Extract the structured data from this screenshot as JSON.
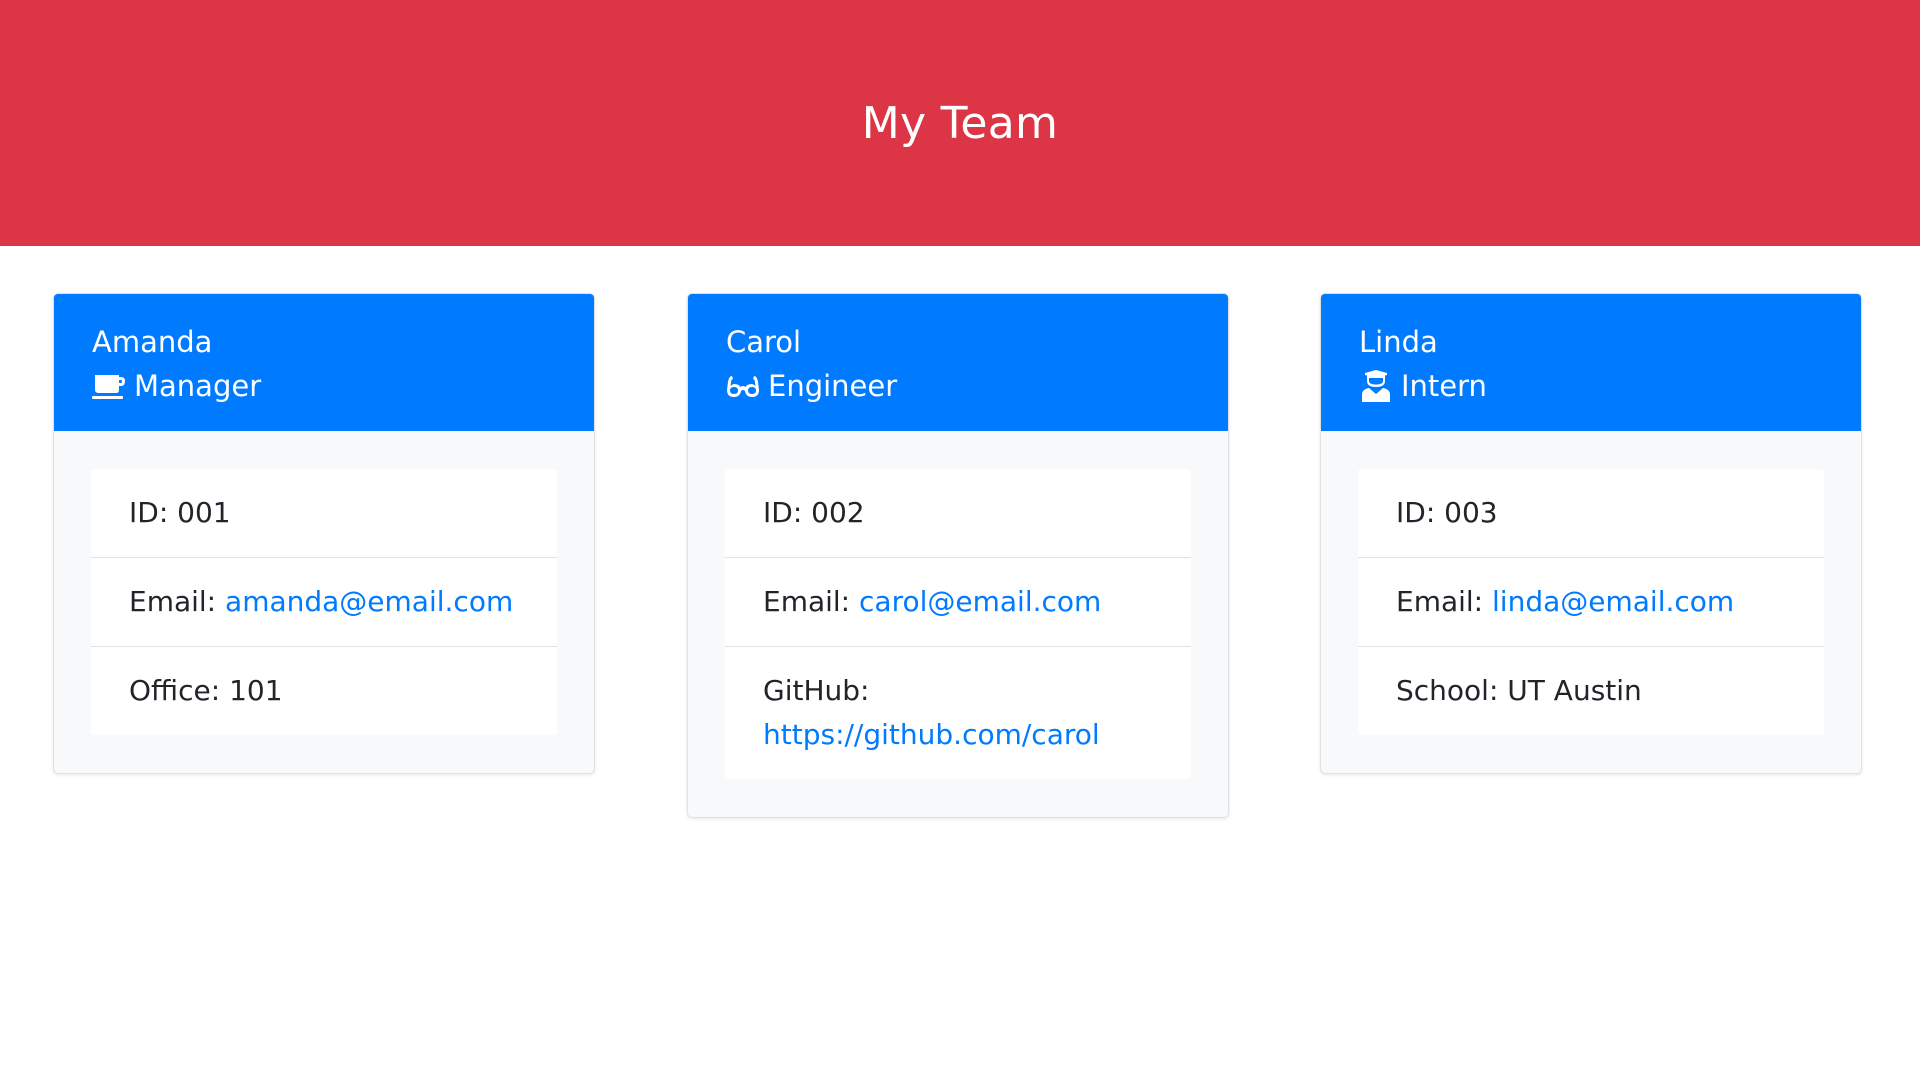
{
  "page": {
    "title": "My Team"
  },
  "colors": {
    "header_background": "#dc3545",
    "card_header": "#007bff",
    "link": "#007bff"
  },
  "employees": [
    {
      "name": "Amanda",
      "role": "Manager",
      "role_icon": "coffee-mug-icon",
      "id_label": "ID:",
      "id": "001",
      "email_label": "Email:",
      "email": "amanda@email.com",
      "extra_label": "Office:",
      "extra_value": "101"
    },
    {
      "name": "Carol",
      "role": "Engineer",
      "role_icon": "glasses-icon",
      "id_label": "ID:",
      "id": "002",
      "email_label": "Email:",
      "email": "carol@email.com",
      "extra_label": "GitHub:",
      "extra_value": "https://github.com/carol"
    },
    {
      "name": "Linda",
      "role": "Intern",
      "role_icon": "graduate-icon",
      "id_label": "ID:",
      "id": "003",
      "email_label": "Email:",
      "email": "linda@email.com",
      "extra_label": "School:",
      "extra_value": "UT Austin"
    }
  ]
}
